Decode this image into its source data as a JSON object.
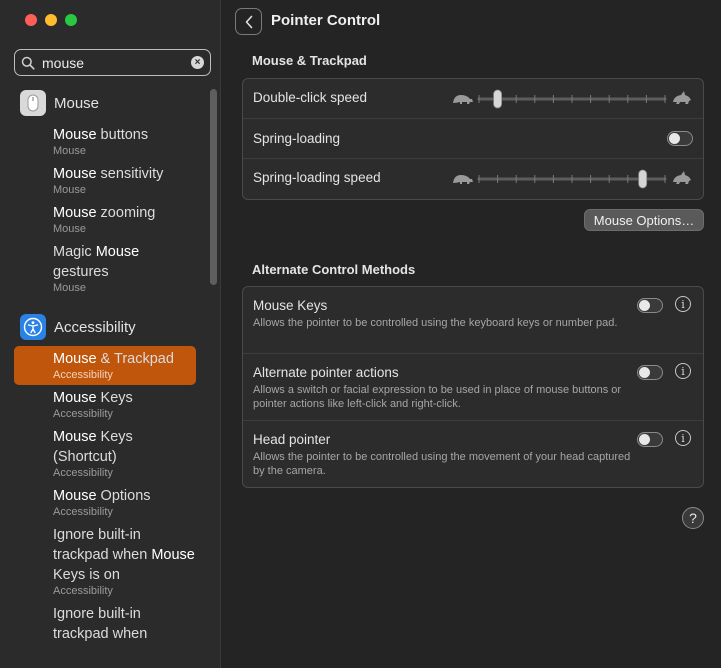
{
  "search": {
    "value": "mouse"
  },
  "sidebar": {
    "groups": [
      {
        "label": "Mouse",
        "items": [
          {
            "pre": "",
            "match": "Mouse",
            "post": " buttons",
            "sub": "Mouse"
          },
          {
            "pre": "",
            "match": "Mouse",
            "post": " sensitivity",
            "sub": "Mouse"
          },
          {
            "pre": "",
            "match": "Mouse",
            "post": " zooming",
            "sub": "Mouse"
          },
          {
            "pre": "Magic ",
            "match": "Mouse",
            "post": " gestures",
            "sub": "Mouse"
          }
        ]
      },
      {
        "label": "Accessibility",
        "items": [
          {
            "pre": "",
            "match": "Mouse",
            "post": " & Trackpad",
            "sub": "Accessibility",
            "selected": true
          },
          {
            "pre": "",
            "match": "Mouse",
            "post": " Keys",
            "sub": "Accessibility"
          },
          {
            "pre": "",
            "match": "Mouse",
            "post": " Keys (Shortcut)",
            "sub": "Accessibility"
          },
          {
            "pre": "",
            "match": "Mouse",
            "post": " Options",
            "sub": "Accessibility"
          },
          {
            "pre": "Ignore built-in trackpad when ",
            "match": "Mouse",
            "post": " Keys is on",
            "sub": "Accessibility"
          },
          {
            "pre": "Ignore built-in trackpad when",
            "match": "",
            "post": "",
            "sub": ""
          }
        ]
      }
    ]
  },
  "header": {
    "title": "Pointer Control"
  },
  "mouse_trackpad": {
    "title": "Mouse & Trackpad",
    "double_click": {
      "label": "Double-click speed",
      "level": 0.1
    },
    "spring_loading": {
      "label": "Spring-loading",
      "on": false
    },
    "spring_speed": {
      "label": "Spring-loading speed",
      "level": 0.88
    },
    "options_button": "Mouse Options…"
  },
  "alternate": {
    "title": "Alternate Control Methods",
    "rows": [
      {
        "label": "Mouse Keys",
        "desc": "Allows the pointer to be controlled using the keyboard keys or number pad.",
        "on": false
      },
      {
        "label": "Alternate pointer actions",
        "desc": "Allows a switch or facial expression to be used in place of mouse buttons or pointer actions like left-click and right-click.",
        "on": false
      },
      {
        "label": "Head pointer",
        "desc": "Allows the pointer to be controlled using the movement of your head captured by the camera.",
        "on": false
      }
    ]
  },
  "help": "?"
}
